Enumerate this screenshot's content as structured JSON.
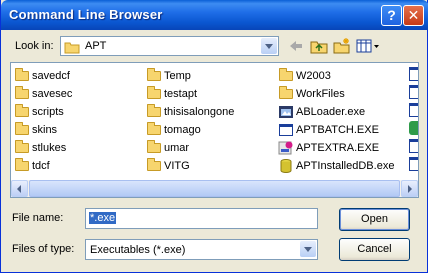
{
  "window": {
    "title": "Command Line Browser"
  },
  "titlebar": {
    "help_glyph": "?",
    "close_glyph": "✕"
  },
  "lookin": {
    "label": "Look in:",
    "value": "APT"
  },
  "toolbar": {
    "icons": [
      "back-arrow-icon",
      "up-folder-icon",
      "new-folder-icon",
      "view-menu-icon"
    ]
  },
  "files": {
    "col1": [
      {
        "name": "savedcf",
        "type": "folder"
      },
      {
        "name": "savesec",
        "type": "folder"
      },
      {
        "name": "scripts",
        "type": "folder"
      },
      {
        "name": "skins",
        "type": "folder"
      },
      {
        "name": "stlukes",
        "type": "folder"
      },
      {
        "name": "tdcf",
        "type": "folder"
      }
    ],
    "col2": [
      {
        "name": "Temp",
        "type": "folder"
      },
      {
        "name": "testapt",
        "type": "folder"
      },
      {
        "name": "thisisalongone",
        "type": "folder"
      },
      {
        "name": "tomago",
        "type": "folder"
      },
      {
        "name": "umar",
        "type": "folder"
      },
      {
        "name": "VITG",
        "type": "folder"
      }
    ],
    "col3": [
      {
        "name": "W2003",
        "type": "folder"
      },
      {
        "name": "WorkFiles",
        "type": "folder"
      },
      {
        "name": "ABLoader.exe",
        "type": "exe"
      },
      {
        "name": "APTBATCH.EXE",
        "type": "exe"
      },
      {
        "name": "APTEXTRA.EXE",
        "type": "exe"
      },
      {
        "name": "APTInstalledDB.exe",
        "type": "exe"
      }
    ]
  },
  "filename": {
    "label": "File name:",
    "value": "*.exe"
  },
  "filetype": {
    "label": "Files of type:",
    "value": "Executables (*.exe)"
  },
  "buttons": {
    "open": "Open",
    "cancel": "Cancel"
  },
  "colors": {
    "title_bar": "#0a56d0",
    "selection": "#316ac5",
    "folder": "#f7d56e",
    "face": "#ece9d8"
  }
}
